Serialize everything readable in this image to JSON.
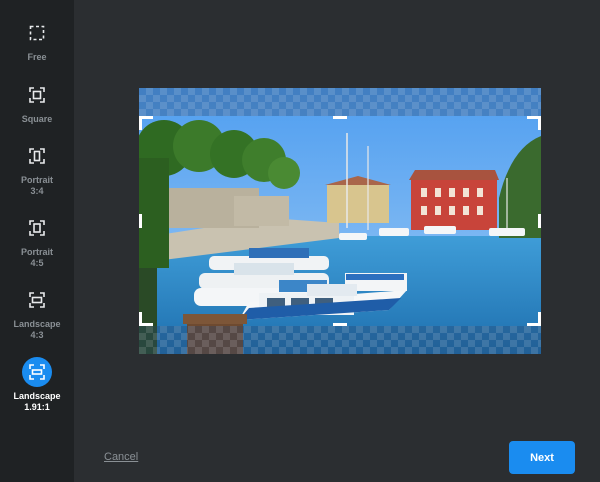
{
  "crop_options": [
    {
      "label_line1": "Free",
      "label_line2": "",
      "icon": "free-crop-icon",
      "active": false
    },
    {
      "label_line1": "Square",
      "label_line2": "",
      "icon": "square-crop-icon",
      "active": false
    },
    {
      "label_line1": "Portrait",
      "label_line2": "3:4",
      "icon": "portrait-crop-icon",
      "active": false
    },
    {
      "label_line1": "Portrait",
      "label_line2": "4:5",
      "icon": "portrait-crop-icon",
      "active": false
    },
    {
      "label_line1": "Landscape",
      "label_line2": "4:3",
      "icon": "landscape-crop-icon",
      "active": false
    },
    {
      "label_line1": "Landscape",
      "label_line2": "1.91:1",
      "icon": "landscape-crop-icon",
      "active": true
    }
  ],
  "footer": {
    "cancel_label": "Cancel",
    "next_label": "Next"
  },
  "colors": {
    "accent": "#1a8cf0",
    "sidebar_bg": "#1f2224",
    "main_bg": "#2b2e31",
    "inactive_text": "#8a9095"
  }
}
